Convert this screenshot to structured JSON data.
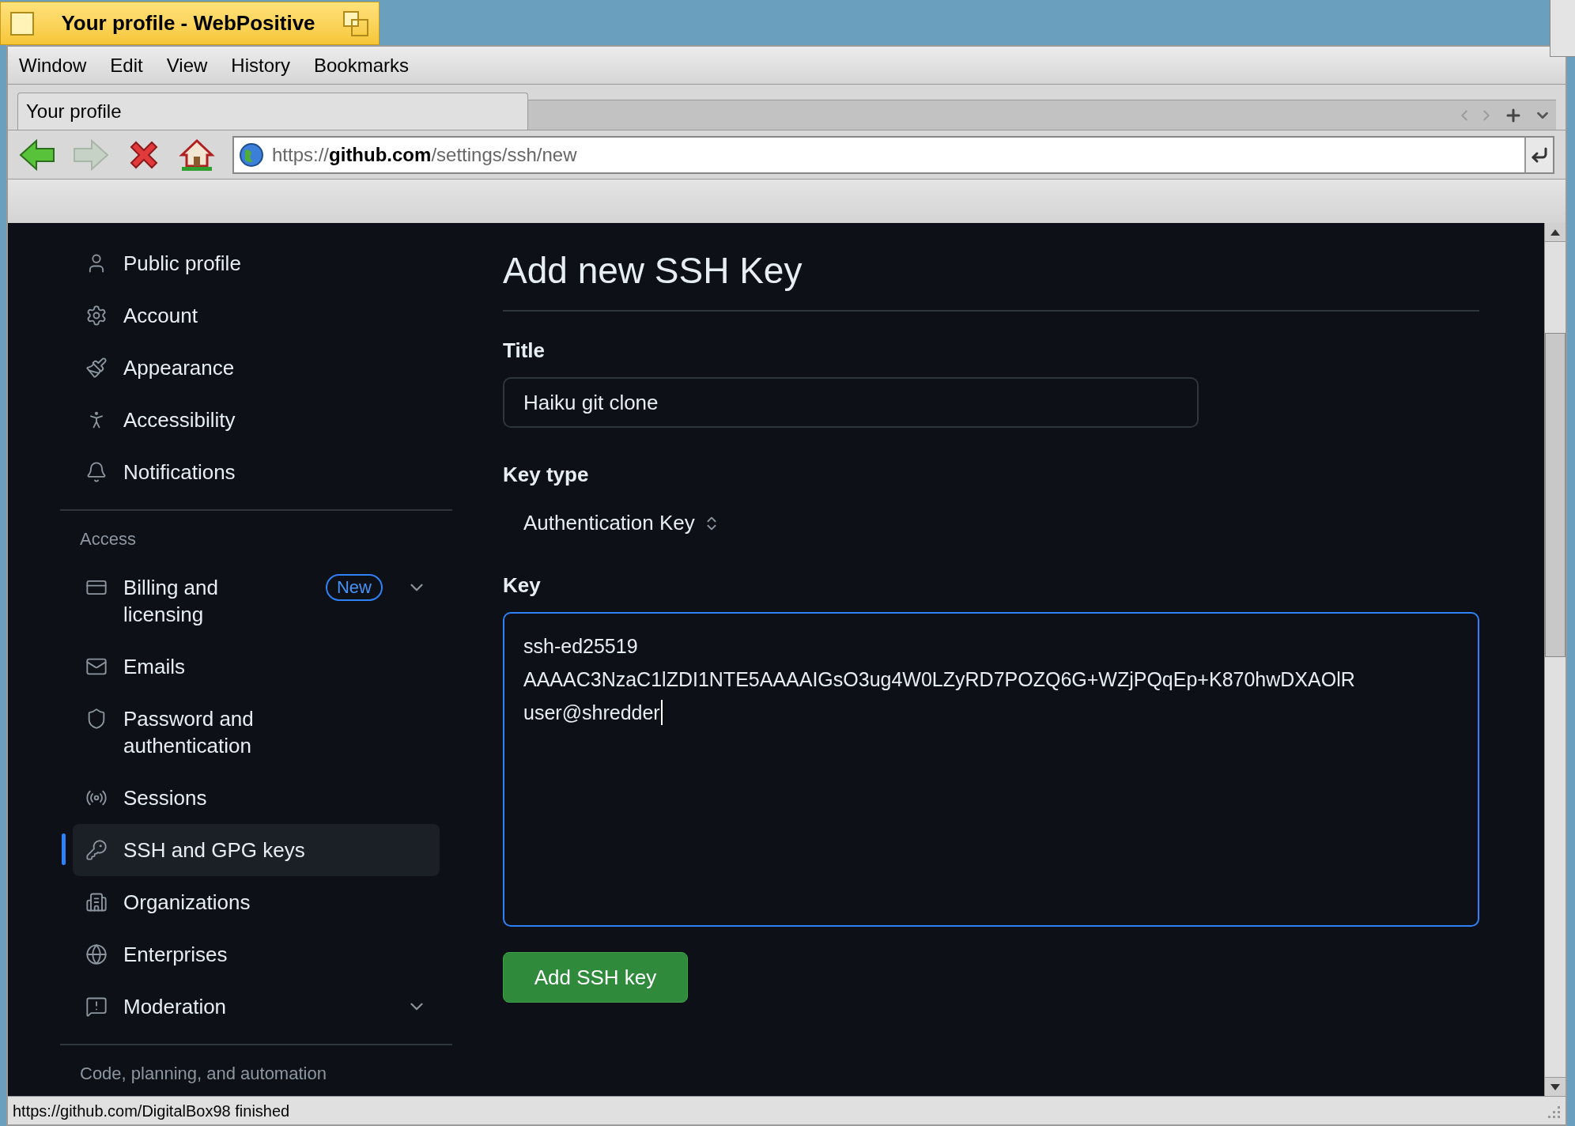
{
  "window": {
    "title": "Your profile - WebPositive"
  },
  "menu": [
    "Window",
    "Edit",
    "View",
    "History",
    "Bookmarks"
  ],
  "tabs": [
    {
      "label": "Your profile",
      "selected": true
    }
  ],
  "url_field": {
    "value": "https://**github.com**/settings/ssh/new"
  },
  "sidebar": {
    "sections": [
      {
        "items": [
          {
            "label": "Public profile",
            "selected": false
          },
          {
            "label": "Account",
            "selected": false
          },
          {
            "label": "Appearance",
            "selected": false
          },
          {
            "label": "Accessibility",
            "selected": false
          },
          {
            "label": "Notifications",
            "selected": false
          }
        ]
      },
      {
        "heading": "Access",
        "items": [
          {
            "label": "Billing and licensing",
            "selected": false,
            "badge": "New",
            "expanded": false
          },
          {
            "label": "Emails",
            "selected": false
          },
          {
            "label": "Password and authentication",
            "selected": false
          },
          {
            "label": "Sessions",
            "selected": false
          },
          {
            "label": "SSH and GPG keys",
            "selected": true
          },
          {
            "label": "Organizations",
            "selected": false
          },
          {
            "label": "Enterprises",
            "selected": false
          },
          {
            "label": "Moderation",
            "selected": false,
            "expanded": false
          }
        ]
      },
      {
        "heading": "Code, planning, and automation"
      }
    ]
  },
  "form": {
    "heading": "Add new SSH Key",
    "title_label": "Title",
    "title_value": "Haiku git clone",
    "key_type_label": "Key type",
    "key_type_value": "Authentication Key",
    "key_label": "Key",
    "key_lines": [
      "ssh-ed25519",
      "AAAAC3NzaC1lZDI1NTE5AAAAIGsO3ug4W0LZyRD7POZQ6G+WZjPQqEp+K870hwDXAOlR",
      "user@shredder"
    ],
    "key_focused": true,
    "submit": "Add SSH key"
  },
  "status_bar": "https://github.com/DigitalBox98 finished"
}
